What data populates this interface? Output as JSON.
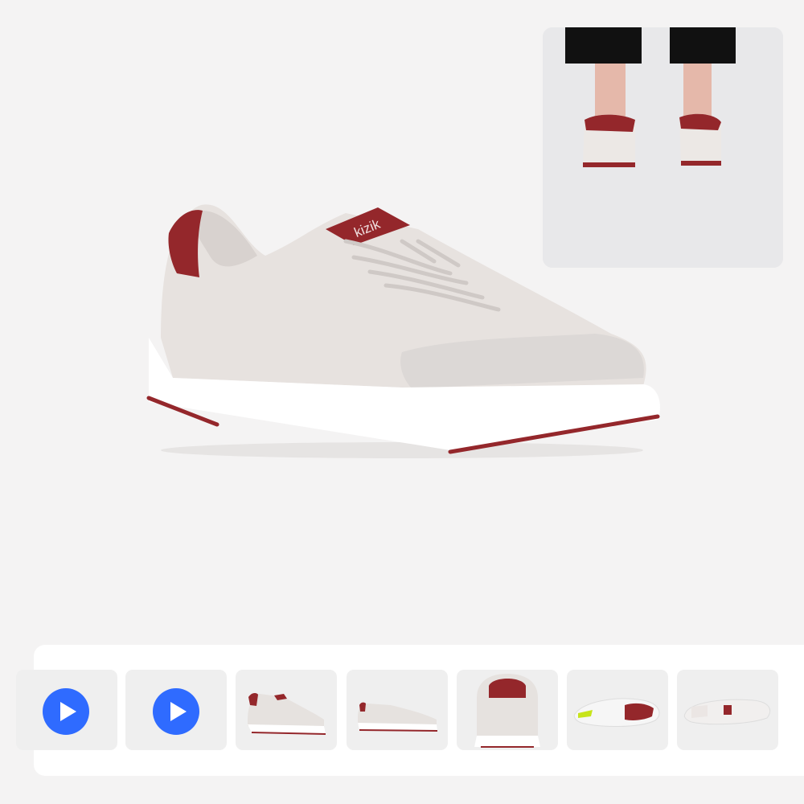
{
  "product": {
    "brand_logo": "kizik"
  },
  "colors": {
    "page_background": "#f4f3f3",
    "upper": "#e7e2df",
    "accent": "#94272b",
    "sole": "#ffffff",
    "play_button": "#2f6bff"
  },
  "icons": {
    "play": "play-icon",
    "expand": "main-image-zoom"
  },
  "thumbnails": [
    {
      "kind": "video",
      "icon": "play-icon"
    },
    {
      "kind": "video",
      "icon": "play-icon"
    },
    {
      "kind": "image",
      "view": "side"
    },
    {
      "kind": "image",
      "view": "side-angle"
    },
    {
      "kind": "image",
      "view": "back"
    },
    {
      "kind": "image",
      "view": "sole"
    },
    {
      "kind": "image",
      "view": "top"
    }
  ]
}
